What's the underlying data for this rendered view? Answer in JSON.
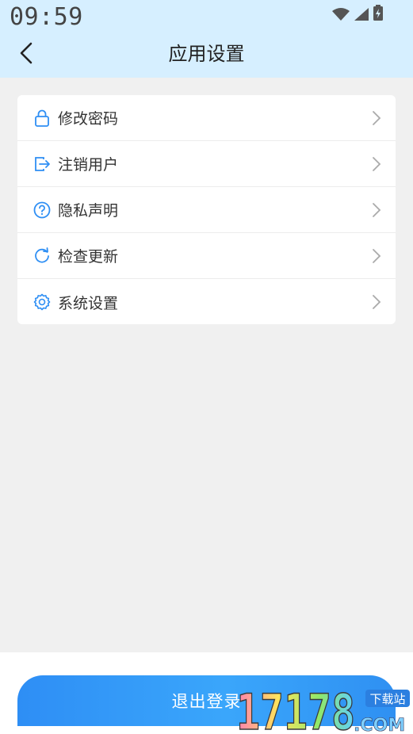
{
  "status_bar": {
    "time": "09:59"
  },
  "header": {
    "title": "应用设置"
  },
  "menu": [
    {
      "label": "修改密码",
      "icon": "lock-icon"
    },
    {
      "label": "注销用户",
      "icon": "logout-door-icon"
    },
    {
      "label": "隐私声明",
      "icon": "question-circle-icon"
    },
    {
      "label": "检查更新",
      "icon": "refresh-icon"
    },
    {
      "label": "系统设置",
      "icon": "gear-icon"
    }
  ],
  "logout_button": {
    "label": "退出登录"
  },
  "watermark": {
    "site": "17178",
    "suffix": ".COM",
    "tag": "下载站"
  },
  "colors": {
    "accent": "#2f8ff4",
    "header_bg": "#d6efff",
    "page_bg": "#f0f0f0"
  }
}
